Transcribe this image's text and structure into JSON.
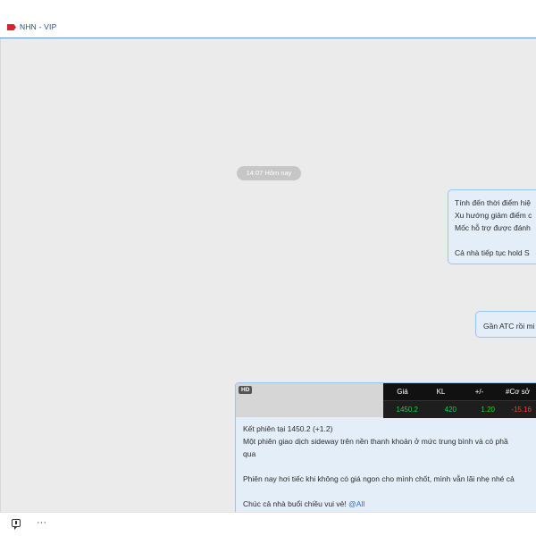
{
  "header": {
    "group_name": "NHN - VIP",
    "tag_icon": "tag-icon",
    "tag_color": "#d9232e"
  },
  "chat": {
    "time_label": "14:07 Hôm nay",
    "messages": [
      {
        "lines": [
          "Tính đến thời điểm hiệ",
          "Xu hướng giảm điểm c",
          "Mốc hỗ trợ được đánh",
          "",
          "Cả nhà tiếp tục hold S"
        ]
      },
      {
        "lines": [
          "Gần ATC rồi mi"
        ]
      },
      {
        "media_badge": "HD",
        "stock_table": {
          "headers": [
            "Giá",
            "KL",
            "+/-",
            "#Cơ sở"
          ],
          "values": [
            "1450.2",
            "420",
            "1.20",
            "-15.16"
          ],
          "value_colors": [
            "#22d13a",
            "#22d13a",
            "#22d13a",
            "#ff3b30"
          ]
        },
        "lines": [
          "Kết phiên tại 1450.2 (+1.2)",
          "Một phiên giao dịch sideway trên nền thanh khoản ở mức trung bình và có phầ",
          "qua",
          "",
          "Phiên nay hơi tiếc khi không có giá ngon cho mình chốt, mình vẫn lãi nhẹ nhé cả",
          "",
          "Chúc cả nhà buổi chiều vui vẻ!"
        ],
        "mention": "@All"
      }
    ]
  },
  "toolbar": {
    "compose_icon": "compose-message-icon",
    "more_icon": "more-options-icon",
    "more_glyph": "···"
  },
  "colors": {
    "accent": "#6a8fd8",
    "bubble_bg": "#e3eef9",
    "bubble_border": "#9fc2ec",
    "mention": "#2f6fd6"
  }
}
